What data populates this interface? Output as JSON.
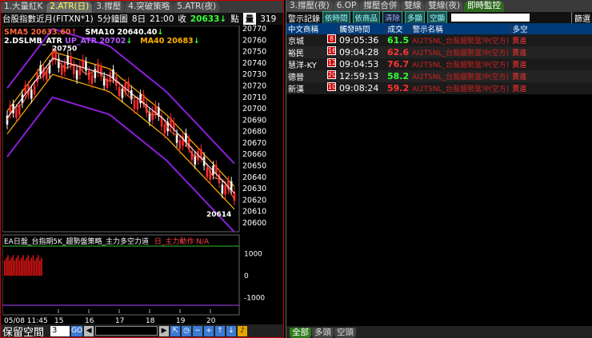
{
  "left": {
    "tabs": [
      "1.大量紅K",
      "2.ATR(日)",
      "3.撐壓",
      "4.突破策略",
      "5.ATR(夜)"
    ],
    "active_tab": 1,
    "info": {
      "symbol": "台股指數近月(FITXN*1)",
      "period": "5分鐘圖",
      "day": "8日",
      "time": "21:00",
      "close_label": "收",
      "close_value": "20633",
      "change_arrow": "↓",
      "unit": "點",
      "qty_label": "量",
      "qty": "319"
    },
    "legend": {
      "sma5": "SMA5 20633.60",
      "sma5_arrow": "↑",
      "sma10": "SMA10 20640.40",
      "sma10_arrow": "↓",
      "dslmb": "2.DSLMB_ATR",
      "up_atr": "UP_ATR 20702",
      "up_atr_arrow": "↓",
      "ma40": "MA40 20683",
      "ma40_arrow": "↓"
    },
    "annotations": {
      "high": "20750",
      "low": "20614"
    },
    "price_axis": [
      "20770",
      "20760",
      "20750",
      "20740",
      "20730",
      "20720",
      "20710",
      "20700",
      "20690",
      "20680",
      "20670",
      "20660",
      "20650",
      "20640",
      "20630",
      "20620",
      "20610",
      "20600"
    ],
    "indicator": {
      "title": "EA日盤_台指期5K_趨勢盤策略_主力多空力道",
      "status_label": "日_主力動作",
      "status_value": "N/A",
      "axis": [
        "1000",
        "0",
        "-1000"
      ]
    },
    "time_axis": {
      "datetime": "05/08 11:45",
      "ticks": [
        "15",
        "16",
        "17",
        "18",
        "19",
        "20"
      ]
    },
    "bottom": {
      "title": "保留空間",
      "spin_value": "3",
      "go_label": "GO"
    },
    "colors": {
      "up": "#ff2a2a",
      "down": "#f5f5f5",
      "sma5": "#ff6a3d",
      "sma10": "#ffffff",
      "ma40": "#ffb000",
      "atr_band": "#8a1fd8"
    }
  },
  "right": {
    "tabs": [
      "3.撐壓(夜)",
      "6.OP",
      "撐壓合併",
      "雙線",
      "雙線(夜)",
      "即時監控"
    ],
    "active_tab": 5,
    "toolbar": {
      "title": "警示記錄",
      "chips": [
        "依時間",
        "依商品",
        "清除",
        "多顯",
        "空顯"
      ],
      "filter": "篩選"
    },
    "table": {
      "headers": [
        "中文商稱",
        "觸發時間",
        "成交",
        "警示名稱",
        "多空"
      ],
      "rows": [
        {
          "name": "京城",
          "count": "8",
          "time": "09:05:36",
          "price": "61.5",
          "alert": "AI2TSNL_台股趨勢當沖(空方)",
          "side": "賣進",
          "up": true
        },
        {
          "name": "裕民",
          "count": "16",
          "time": "09:04:28",
          "price": "62.6",
          "alert": "AI2TSNL_台股趨勢當沖(空方)",
          "side": "賣進",
          "up": false
        },
        {
          "name": "慧洋-KY",
          "count": "12",
          "time": "09:04:53",
          "price": "76.7",
          "alert": "AI2TSNL_台股趨勢當沖(空方)",
          "side": "賣進",
          "up": false
        },
        {
          "name": "德晉",
          "count": "20",
          "time": "12:59:13",
          "price": "58.2",
          "alert": "AI2TSNL_台股趨勢當沖(空方)",
          "side": "賣進",
          "up": true
        },
        {
          "name": "新漢",
          "count": "10",
          "time": "09:08:24",
          "price": "59.2",
          "alert": "AI2TSNL_台股趨勢當沖(空方)",
          "side": "賣進",
          "up": false
        }
      ]
    },
    "bottom_tabs": [
      "全部",
      "多頭",
      "空頭"
    ],
    "active_bottom_tab": 0
  },
  "chart_data": {
    "type": "candlestick",
    "title": "台股指數近月(FITXN*1) 5分鐘圖",
    "ylim": [
      20600,
      20770
    ],
    "x_ticks": [
      "15",
      "16",
      "17",
      "18",
      "19",
      "20"
    ],
    "high": 20750,
    "low": 20614,
    "close": 20633,
    "series": [
      {
        "name": "SMA5",
        "last": 20633.6
      },
      {
        "name": "SMA10",
        "last": 20640.4
      },
      {
        "name": "UP_ATR",
        "last": 20702
      },
      {
        "name": "MA40",
        "last": 20683
      }
    ],
    "indicator_ylim": [
      -1500,
      1500
    ]
  }
}
